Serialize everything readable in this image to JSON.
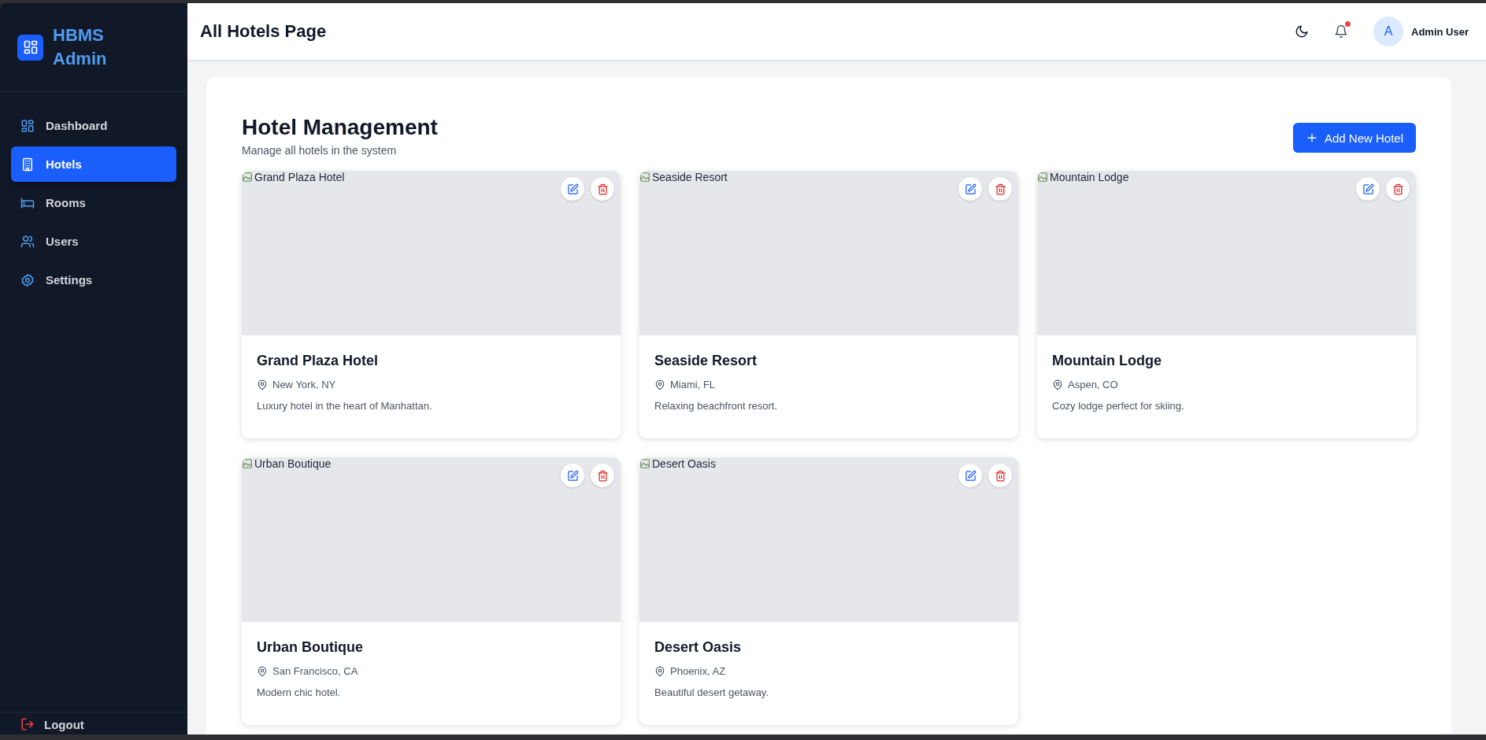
{
  "sidebar": {
    "brand": {
      "line_1": "HBMS",
      "line_2": "Admin"
    },
    "items": [
      {
        "label": "Dashboard",
        "selected": false
      },
      {
        "label": "Hotels",
        "selected": true
      },
      {
        "label": "Rooms",
        "selected": false
      },
      {
        "label": "Users",
        "selected": false
      },
      {
        "label": "Settings",
        "selected": false
      }
    ],
    "logout": "Logout"
  },
  "header": {
    "title": "All Hotels Page",
    "notifications_unread": true,
    "avatar_initial": "A",
    "user_name": "Admin User"
  },
  "page": {
    "title": "Hotel Management",
    "subtitle": "Manage all hotels in the system",
    "add_button": "Add New Hotel"
  },
  "hotels": [
    {
      "image_alt": "Grand Plaza Hotel",
      "name": "Grand Plaza Hotel",
      "location": "New York, NY",
      "description": "Luxury hotel in the heart of Manhattan."
    },
    {
      "image_alt": "Seaside Resort",
      "name": "Seaside Resort",
      "location": "Miami, FL",
      "description": "Relaxing beachfront resort."
    },
    {
      "image_alt": "Mountain Lodge",
      "name": "Mountain Lodge",
      "location": "Aspen, CO",
      "description": "Cozy lodge perfect for skiing."
    },
    {
      "image_alt": "Urban Boutique",
      "name": "Urban Boutique",
      "location": "San Francisco, CA",
      "description": "Modern chic hotel."
    },
    {
      "image_alt": "Desert Oasis",
      "name": "Desert Oasis",
      "location": "Phoenix, AZ",
      "description": "Beautiful desert getaway."
    }
  ]
}
